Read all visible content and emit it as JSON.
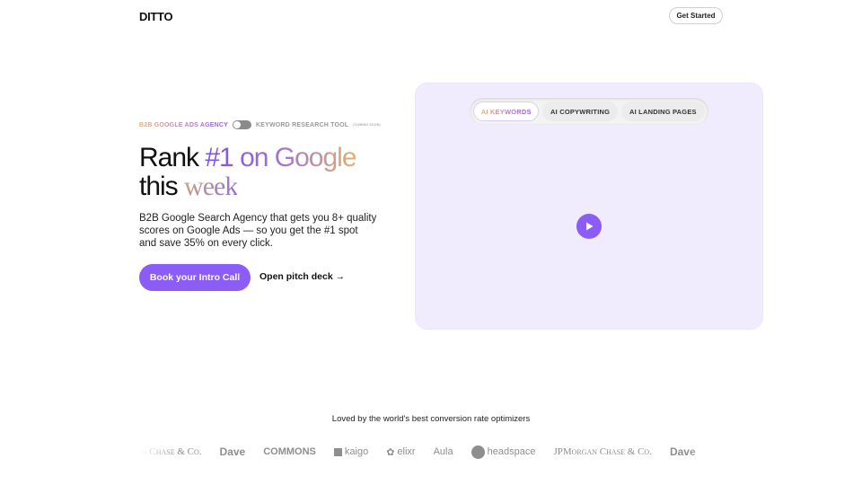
{
  "nav": {
    "logo": "DITTO",
    "cta": "Get Started"
  },
  "hero": {
    "eyebrow_left": "B2B GOOGLE ADS AGENCY",
    "eyebrow_right": "KEYWORD RESEARCH TOOL",
    "eyebrow_note": "(COMING SOON)",
    "toggle_on": false,
    "title_1": "Rank ",
    "title_highlight": "#1 on Google",
    "title_2": "this ",
    "title_week": "week",
    "description": "B2B Google Search Agency that gets you 8+ quality scores on Google Ads — so you get the #1 spot and save 35% on every click.",
    "primary_cta": "Book your Intro Call",
    "secondary_cta": "Open pitch deck",
    "secondary_icon": "arrow-right-icon"
  },
  "video": {
    "tabs": [
      {
        "label": "AI KEYWORDS",
        "active": true
      },
      {
        "label": "AI COPYWRITING"
      },
      {
        "label": "AI LANDING PAGES"
      }
    ],
    "play_icon": "play-icon"
  },
  "social_proof": {
    "heading": "Loved by the world's best conversion rate optimizers",
    "logos": [
      "JPMorgan Chase & Co.",
      "Dave",
      "COMMONS",
      "kaigo",
      "elixr",
      "Aula",
      "headspace",
      "JPMorgan Chase & Co.",
      "Dave"
    ]
  },
  "colors": {
    "accent": "#8b5cf6",
    "panel": "#f1ecfd"
  }
}
